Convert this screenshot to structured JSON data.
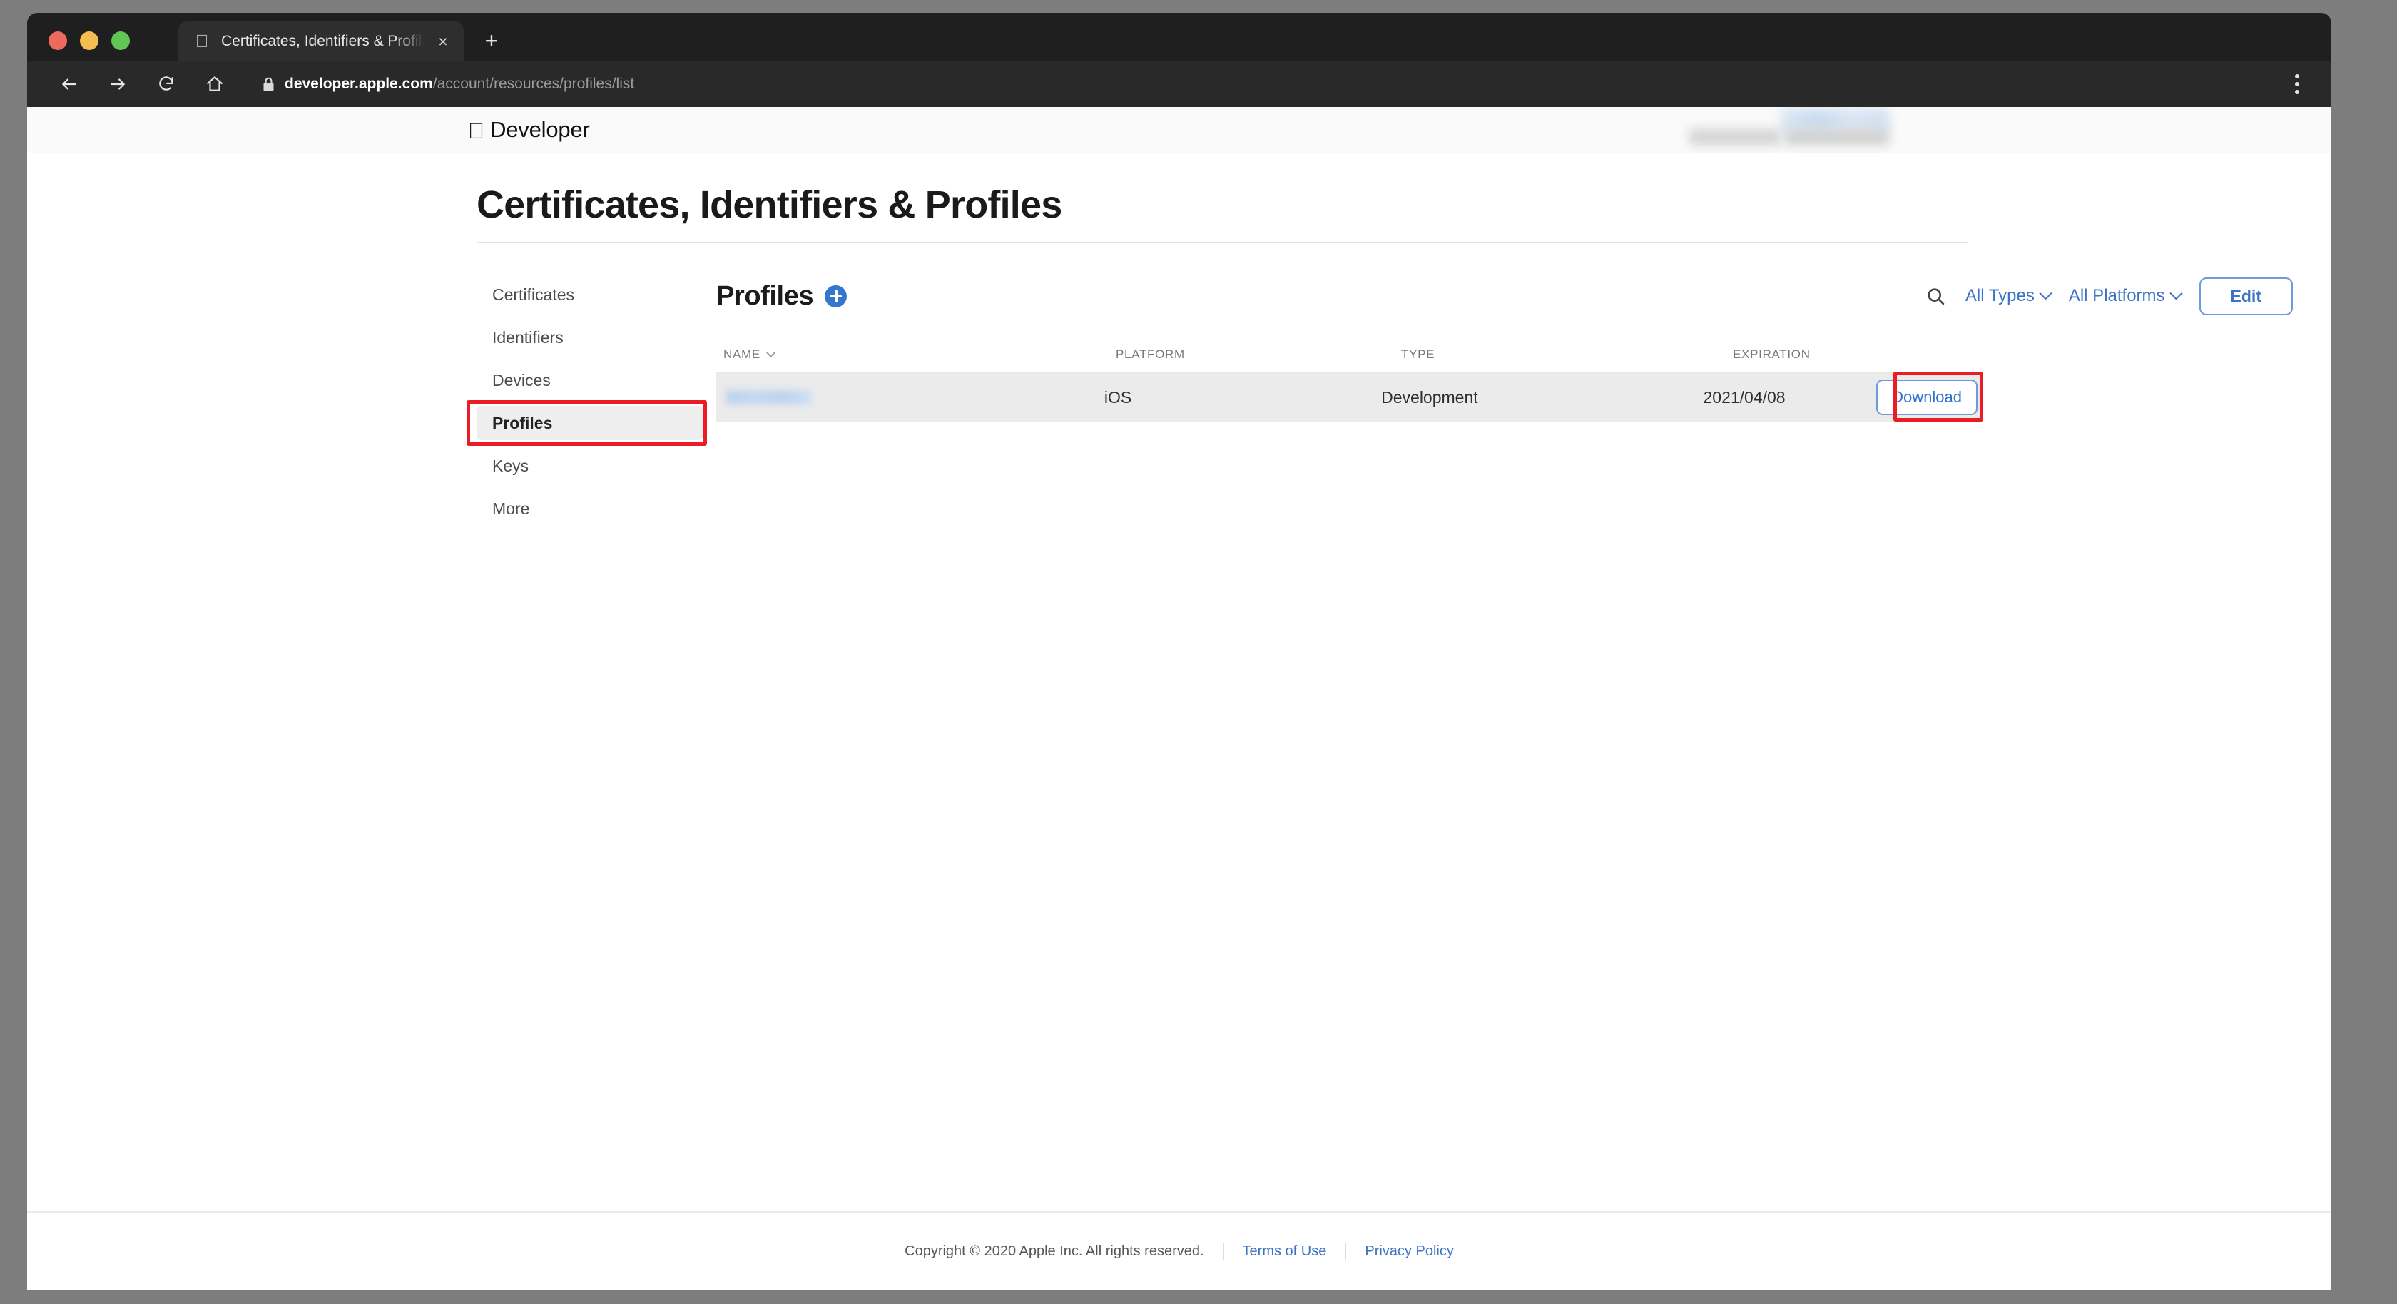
{
  "browser": {
    "tab": {
      "title": "Certificates, Identifiers & Profiles",
      "favicon": "apple-logo-icon",
      "close": "×"
    },
    "new_tab_label": "+",
    "toolbar": {
      "back": "back-arrow-icon",
      "forward": "forward-arrow-icon",
      "reload": "reload-icon",
      "home": "home-icon",
      "lock": "lock-icon",
      "url_domain": "developer.apple.com",
      "url_path": "/account/resources/profiles/list",
      "menu": "kebab-menu-icon"
    }
  },
  "site_header": {
    "apple_glyph": "",
    "brand": "Developer"
  },
  "page": {
    "title": "Certificates, Identifiers & Profiles"
  },
  "sidebar": {
    "items": [
      {
        "label": "Certificates",
        "active": false
      },
      {
        "label": "Identifiers",
        "active": false
      },
      {
        "label": "Devices",
        "active": false
      },
      {
        "label": "Profiles",
        "active": true
      },
      {
        "label": "Keys",
        "active": false
      },
      {
        "label": "More",
        "active": false
      }
    ]
  },
  "main": {
    "title": "Profiles",
    "add_button": "add-profile-icon",
    "search_icon": "search-icon",
    "filters": [
      {
        "label": "All Types"
      },
      {
        "label": "All Platforms"
      }
    ],
    "edit_label": "Edit",
    "table": {
      "columns": [
        "NAME",
        "PLATFORM",
        "TYPE",
        "EXPIRATION"
      ],
      "rows": [
        {
          "name": "",
          "name_redacted": true,
          "platform": "iOS",
          "type": "Development",
          "expiration": "2021/04/08",
          "action": "Download"
        }
      ]
    }
  },
  "footer": {
    "copyright": "Copyright © 2020 Apple Inc. All rights reserved.",
    "terms": "Terms of Use",
    "privacy": "Privacy Policy"
  },
  "annotations": {
    "accent_color": "#ec1c24",
    "targets": [
      "sidebar-item-profiles",
      "download-button"
    ]
  }
}
